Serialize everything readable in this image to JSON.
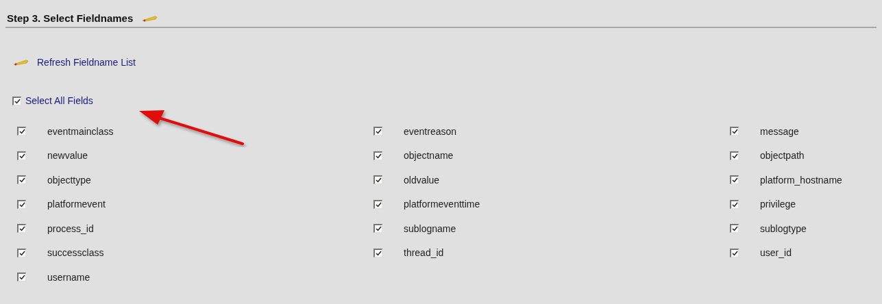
{
  "section": {
    "title": "Step 3. Select Fieldnames"
  },
  "refresh_link": {
    "label": "Refresh Fieldname List"
  },
  "select_all": {
    "label": "Select All Fields",
    "checked": true
  },
  "fields": [
    {
      "label": "eventmainclass",
      "checked": true
    },
    {
      "label": "eventreason",
      "checked": true
    },
    {
      "label": "message",
      "checked": true
    },
    {
      "label": "newvalue",
      "checked": true
    },
    {
      "label": "objectname",
      "checked": true
    },
    {
      "label": "objectpath",
      "checked": true
    },
    {
      "label": "objecttype",
      "checked": true
    },
    {
      "label": "oldvalue",
      "checked": true
    },
    {
      "label": "platform_hostname",
      "checked": true
    },
    {
      "label": "platformevent",
      "checked": true
    },
    {
      "label": "platformeventtime",
      "checked": true
    },
    {
      "label": "privilege",
      "checked": true
    },
    {
      "label": "process_id",
      "checked": true
    },
    {
      "label": "sublogname",
      "checked": true
    },
    {
      "label": "sublogtype",
      "checked": true
    },
    {
      "label": "successclass",
      "checked": true
    },
    {
      "label": "thread_id",
      "checked": true
    },
    {
      "label": "user_id",
      "checked": true
    },
    {
      "label": "username",
      "checked": true
    }
  ]
}
